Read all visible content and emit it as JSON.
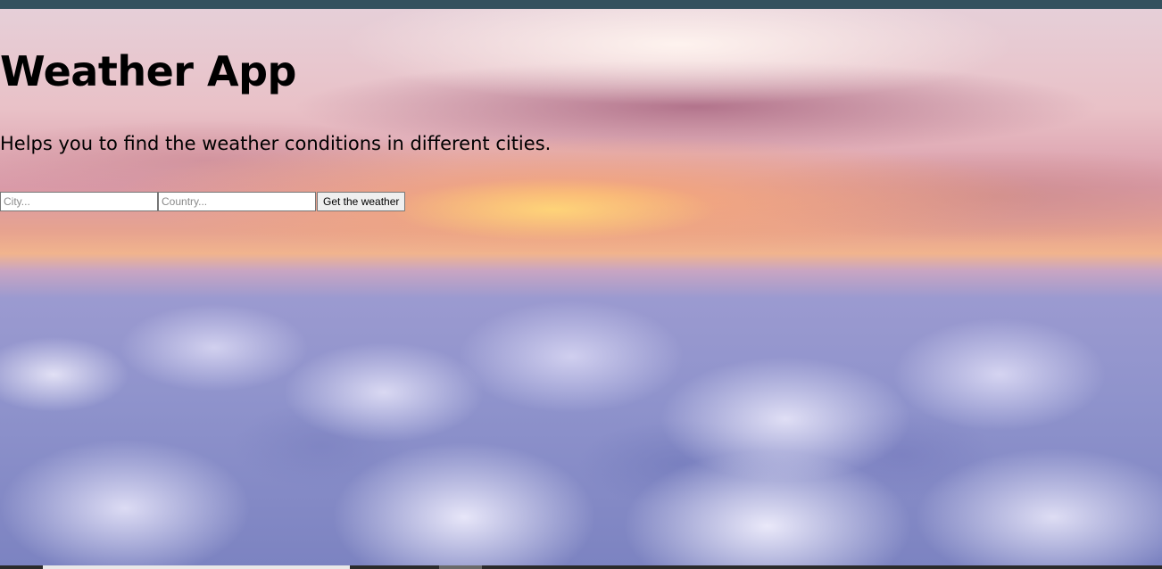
{
  "page": {
    "title": "Weather App",
    "subtitle": "Helps you to find the weather conditions in different cities."
  },
  "form": {
    "city_placeholder": "City...",
    "city_value": "",
    "country_placeholder": "Country...",
    "country_value": "",
    "submit_label": "Get the weather"
  },
  "background": {
    "description_icon": "sky-clouds-sunset-image"
  }
}
